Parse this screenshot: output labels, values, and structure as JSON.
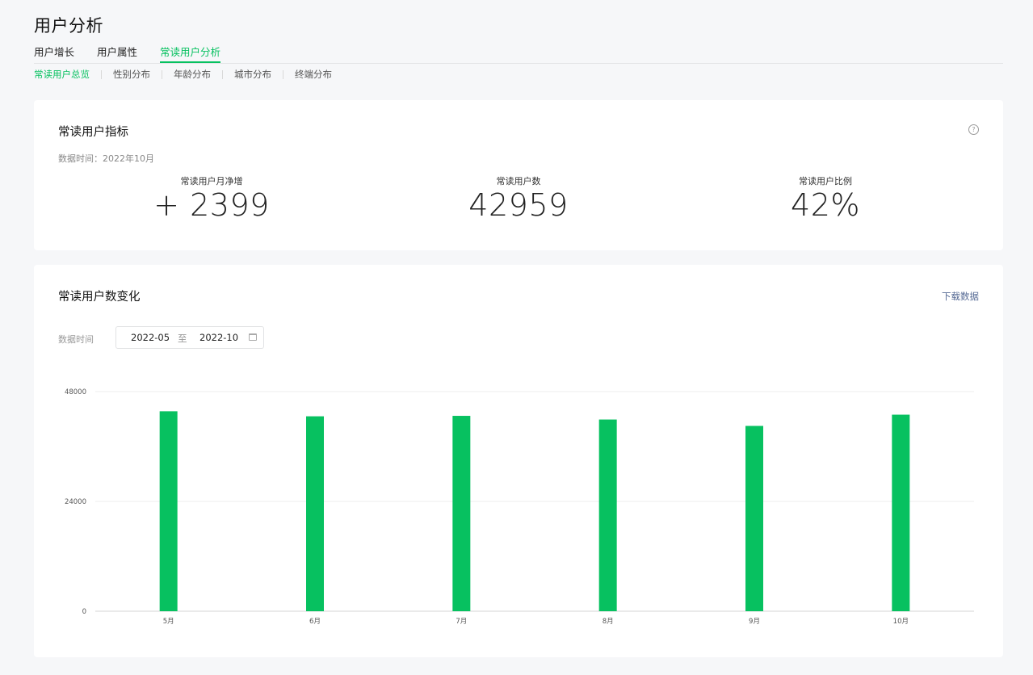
{
  "page": {
    "title": "用户分析"
  },
  "tabs": [
    {
      "label": "用户增长",
      "active": false
    },
    {
      "label": "用户属性",
      "active": false
    },
    {
      "label": "常读用户分析",
      "active": true
    }
  ],
  "subtabs": [
    {
      "label": "常读用户总览",
      "active": true
    },
    {
      "label": "性别分布",
      "active": false
    },
    {
      "label": "年龄分布",
      "active": false
    },
    {
      "label": "城市分布",
      "active": false
    },
    {
      "label": "终端分布",
      "active": false
    }
  ],
  "metrics_card": {
    "title": "常读用户指标",
    "help_icon": "question-circle-icon",
    "data_time": "数据时间：2022年10月",
    "metrics": [
      {
        "label": "常读用户月净增",
        "value": "+ 2399"
      },
      {
        "label": "常读用户数",
        "value": "42959"
      },
      {
        "label": "常读用户比例",
        "value": "42%"
      }
    ]
  },
  "trend_card": {
    "title": "常读用户数变化",
    "download_label": "下载数据",
    "range_label": "数据时间",
    "range_start": "2022-05",
    "range_to": "至",
    "range_end": "2022-10",
    "calendar_icon": "calendar-icon"
  },
  "chart_data": {
    "type": "bar",
    "categories": [
      "5月",
      "6月",
      "7月",
      "8月",
      "9月",
      "10月"
    ],
    "values": [
      43700,
      42600,
      42700,
      41900,
      40500,
      42959
    ],
    "ylim": [
      0,
      48000
    ],
    "yticks": [
      "0",
      "24000",
      "48000"
    ],
    "grid": true,
    "bar_color": "#07c160"
  },
  "colors": {
    "accent": "#07c160",
    "link": "#576b95",
    "background": "#f6f7f9"
  }
}
